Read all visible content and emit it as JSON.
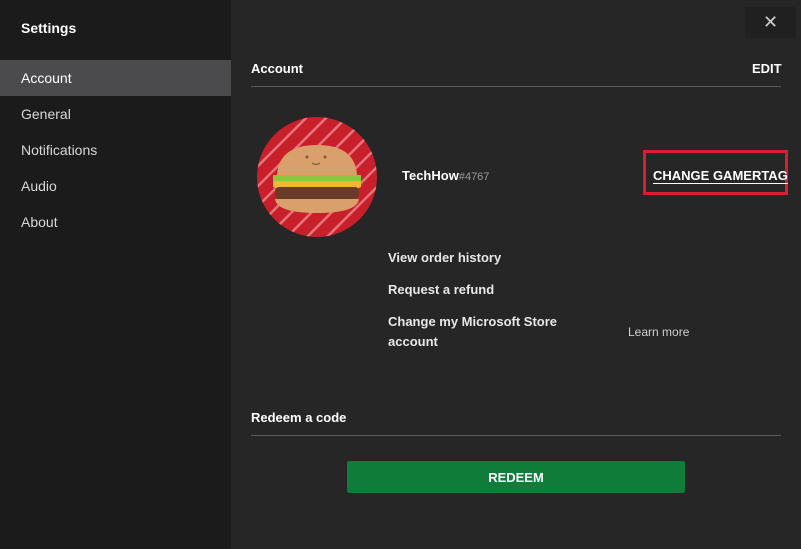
{
  "sidebar": {
    "title": "Settings",
    "items": [
      {
        "label": "Account"
      },
      {
        "label": "General"
      },
      {
        "label": "Notifications"
      },
      {
        "label": "Audio"
      },
      {
        "label": "About"
      }
    ],
    "active_index": 0
  },
  "window": {
    "close_icon": "close-icon",
    "close_glyph": "✕"
  },
  "account": {
    "title": "Account",
    "edit_label": "EDIT",
    "gamertag": "TechHow",
    "gamertag_suffix": "#4767",
    "change_gamertag_label": "CHANGE GAMERTAG",
    "links": {
      "view_orders": "View order history",
      "refund": "Request a refund",
      "change_store_account": "Change my Microsoft Store account",
      "learn_more": "Learn more"
    }
  },
  "redeem": {
    "title": "Redeem a code",
    "button_label": "REDEEM"
  },
  "colors": {
    "accent_green": "#107c3a",
    "highlight_red": "#d7202e",
    "avatar_red": "#c8202b"
  }
}
